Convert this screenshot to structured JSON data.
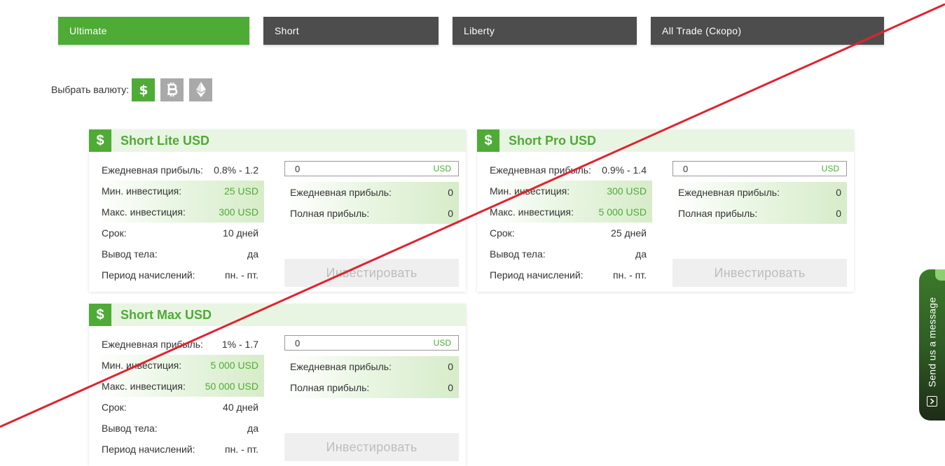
{
  "tabs": [
    {
      "label": "Ultimate"
    },
    {
      "label": "Short"
    },
    {
      "label": "Liberty"
    },
    {
      "label": "All Trade (Скоро)"
    }
  ],
  "currency": {
    "label": "Выбрать валюту:",
    "options": [
      "dollar-icon",
      "bitcoin-icon",
      "ethereum-icon"
    ],
    "active": "dollar-icon"
  },
  "colors": {
    "accent": "#4eab35",
    "tab_inactive": "#4d4d4d",
    "strike": "#e02230"
  },
  "labels": {
    "daily_profit": "Ежедневная прибыль:",
    "min_invest": "Мин. инвестиция:",
    "max_invest": "Макс. инвестиция:",
    "term": "Срок:",
    "withdraw": "Вывод тела:",
    "period": "Период начислений:",
    "calc_daily": "Ежедневная прибыль:",
    "calc_total": "Полная прибыль:",
    "invest_button": "Инвестировать",
    "dollar_symbol": "$"
  },
  "cards": [
    {
      "title": "Short Lite USD",
      "daily": "0.8% - 1.2",
      "min": "25 USD",
      "max": "300 USD",
      "term": "10 дней",
      "withdraw": "да",
      "period": "пн. - пт.",
      "amount": "0",
      "amount_unit": "USD",
      "calc_daily": "0",
      "calc_total": "0"
    },
    {
      "title": "Short Pro USD",
      "daily": "0.9% - 1.4",
      "min": "300 USD",
      "max": "5 000 USD",
      "term": "25 дней",
      "withdraw": "да",
      "period": "пн. - пт.",
      "amount": "0",
      "amount_unit": "USD",
      "calc_daily": "0",
      "calc_total": "0"
    },
    {
      "title": "Short Max USD",
      "daily": "1% - 1.7",
      "min": "5 000 USD",
      "max": "50 000 USD",
      "term": "40 дней",
      "withdraw": "да",
      "period": "пн. - пт.",
      "amount": "0",
      "amount_unit": "USD",
      "calc_daily": "0",
      "calc_total": "0"
    }
  ],
  "widget": {
    "label": "Send us a message"
  }
}
